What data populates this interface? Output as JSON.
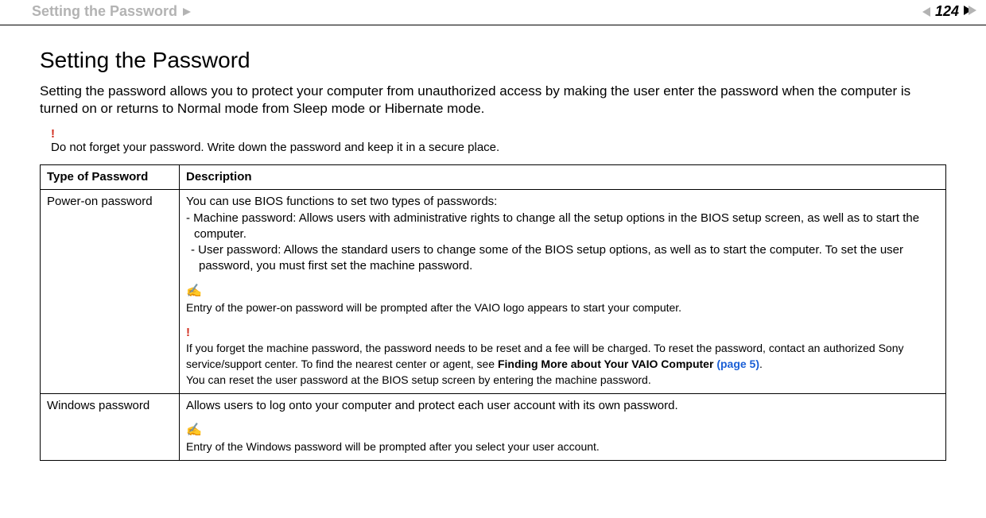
{
  "header": {
    "breadcrumb": "Setting the Password",
    "page_number": "124"
  },
  "title": "Setting the Password",
  "intro": "Setting the password allows you to protect your computer from unauthorized access by making the user enter the password when the computer is turned on or returns to Normal mode from Sleep mode or Hibernate mode.",
  "warning_mark": "!",
  "warning_text": "Do not forget your password. Write down the password and keep it in a secure place.",
  "table": {
    "headers": {
      "type": "Type of Password",
      "desc": "Description"
    },
    "rows": {
      "poweron": {
        "type": "Power-on password",
        "intro": "You can use BIOS functions to set two types of passwords:",
        "b1": "- Machine password: Allows users with administrative rights to change all the setup options in the BIOS setup screen, as well as to start the computer.",
        "b2": "- User password: Allows the standard users to change some of the BIOS setup options, as well as to start the computer. To set the user password, you must first set the machine password.",
        "note_icon": "✍",
        "note": "Entry of the power-on password will be prompted after the VAIO logo appears to start your computer.",
        "warn_mark": "!",
        "warn1a": "If you forget the machine password, the password needs to be reset and a fee will be charged. To reset the password, contact an authorized Sony service/support center. To find the nearest center or agent, see ",
        "warn1b_bold": "Finding More about Your VAIO Computer ",
        "warn1b_link": "(page 5)",
        "warn1c": ".",
        "warn2": "You can reset the user password at the BIOS setup screen by entering the machine password."
      },
      "windows": {
        "type": "Windows password",
        "desc": "Allows users to log onto your computer and protect each user account with its own password.",
        "note_icon": "✍",
        "note": "Entry of the Windows password will be prompted after you select your user account."
      }
    }
  }
}
